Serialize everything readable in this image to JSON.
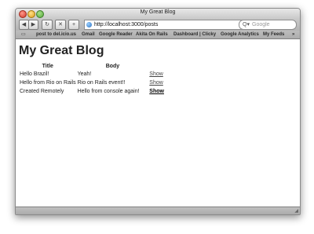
{
  "window": {
    "title": "My Great Blog"
  },
  "toolbar": {
    "back_icon": "back-arrow-icon",
    "forward_icon": "forward-arrow-icon",
    "reload_icon": "reload-icon",
    "stop_icon": "stop-icon",
    "add_icon": "add-bookmark-icon",
    "url": "http://localhost:3000/posts",
    "search_placeholder": "Google"
  },
  "bookmarks": [
    "post to del.icio.us",
    "Gmail",
    "Google Reader",
    "Akita On Rails",
    "Dashboard | Clicky",
    "Google Analytics",
    "My Feeds"
  ],
  "page": {
    "heading": "My Great Blog",
    "table": {
      "headers": [
        "Title",
        "Body",
        ""
      ],
      "rows": [
        {
          "title": "Hello Brazil!",
          "body": "Yeah!",
          "action": "Show"
        },
        {
          "title": "Hello from Rio on Rails",
          "body": "Rio on Rails event!!",
          "action": "Show"
        },
        {
          "title": "Created Remotely",
          "body": "Hello from console again!",
          "action": "Show"
        }
      ]
    }
  }
}
